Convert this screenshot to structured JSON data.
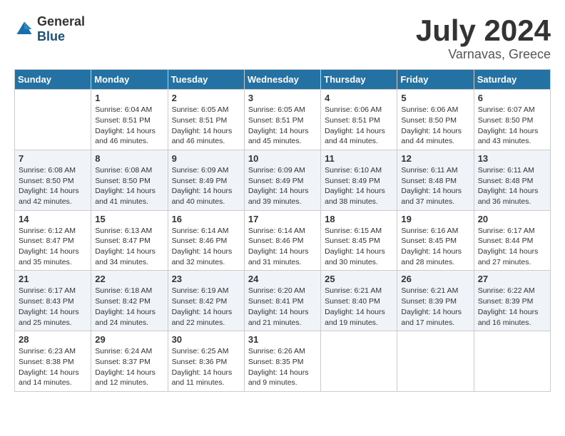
{
  "header": {
    "logo_general": "General",
    "logo_blue": "Blue",
    "month": "July 2024",
    "location": "Varnavas, Greece"
  },
  "weekdays": [
    "Sunday",
    "Monday",
    "Tuesday",
    "Wednesday",
    "Thursday",
    "Friday",
    "Saturday"
  ],
  "weeks": [
    [
      {
        "day": "",
        "info": ""
      },
      {
        "day": "1",
        "info": "Sunrise: 6:04 AM\nSunset: 8:51 PM\nDaylight: 14 hours\nand 46 minutes."
      },
      {
        "day": "2",
        "info": "Sunrise: 6:05 AM\nSunset: 8:51 PM\nDaylight: 14 hours\nand 46 minutes."
      },
      {
        "day": "3",
        "info": "Sunrise: 6:05 AM\nSunset: 8:51 PM\nDaylight: 14 hours\nand 45 minutes."
      },
      {
        "day": "4",
        "info": "Sunrise: 6:06 AM\nSunset: 8:51 PM\nDaylight: 14 hours\nand 44 minutes."
      },
      {
        "day": "5",
        "info": "Sunrise: 6:06 AM\nSunset: 8:50 PM\nDaylight: 14 hours\nand 44 minutes."
      },
      {
        "day": "6",
        "info": "Sunrise: 6:07 AM\nSunset: 8:50 PM\nDaylight: 14 hours\nand 43 minutes."
      }
    ],
    [
      {
        "day": "7",
        "info": "Sunrise: 6:08 AM\nSunset: 8:50 PM\nDaylight: 14 hours\nand 42 minutes."
      },
      {
        "day": "8",
        "info": "Sunrise: 6:08 AM\nSunset: 8:50 PM\nDaylight: 14 hours\nand 41 minutes."
      },
      {
        "day": "9",
        "info": "Sunrise: 6:09 AM\nSunset: 8:49 PM\nDaylight: 14 hours\nand 40 minutes."
      },
      {
        "day": "10",
        "info": "Sunrise: 6:09 AM\nSunset: 8:49 PM\nDaylight: 14 hours\nand 39 minutes."
      },
      {
        "day": "11",
        "info": "Sunrise: 6:10 AM\nSunset: 8:49 PM\nDaylight: 14 hours\nand 38 minutes."
      },
      {
        "day": "12",
        "info": "Sunrise: 6:11 AM\nSunset: 8:48 PM\nDaylight: 14 hours\nand 37 minutes."
      },
      {
        "day": "13",
        "info": "Sunrise: 6:11 AM\nSunset: 8:48 PM\nDaylight: 14 hours\nand 36 minutes."
      }
    ],
    [
      {
        "day": "14",
        "info": "Sunrise: 6:12 AM\nSunset: 8:47 PM\nDaylight: 14 hours\nand 35 minutes."
      },
      {
        "day": "15",
        "info": "Sunrise: 6:13 AM\nSunset: 8:47 PM\nDaylight: 14 hours\nand 34 minutes."
      },
      {
        "day": "16",
        "info": "Sunrise: 6:14 AM\nSunset: 8:46 PM\nDaylight: 14 hours\nand 32 minutes."
      },
      {
        "day": "17",
        "info": "Sunrise: 6:14 AM\nSunset: 8:46 PM\nDaylight: 14 hours\nand 31 minutes."
      },
      {
        "day": "18",
        "info": "Sunrise: 6:15 AM\nSunset: 8:45 PM\nDaylight: 14 hours\nand 30 minutes."
      },
      {
        "day": "19",
        "info": "Sunrise: 6:16 AM\nSunset: 8:45 PM\nDaylight: 14 hours\nand 28 minutes."
      },
      {
        "day": "20",
        "info": "Sunrise: 6:17 AM\nSunset: 8:44 PM\nDaylight: 14 hours\nand 27 minutes."
      }
    ],
    [
      {
        "day": "21",
        "info": "Sunrise: 6:17 AM\nSunset: 8:43 PM\nDaylight: 14 hours\nand 25 minutes."
      },
      {
        "day": "22",
        "info": "Sunrise: 6:18 AM\nSunset: 8:42 PM\nDaylight: 14 hours\nand 24 minutes."
      },
      {
        "day": "23",
        "info": "Sunrise: 6:19 AM\nSunset: 8:42 PM\nDaylight: 14 hours\nand 22 minutes."
      },
      {
        "day": "24",
        "info": "Sunrise: 6:20 AM\nSunset: 8:41 PM\nDaylight: 14 hours\nand 21 minutes."
      },
      {
        "day": "25",
        "info": "Sunrise: 6:21 AM\nSunset: 8:40 PM\nDaylight: 14 hours\nand 19 minutes."
      },
      {
        "day": "26",
        "info": "Sunrise: 6:21 AM\nSunset: 8:39 PM\nDaylight: 14 hours\nand 17 minutes."
      },
      {
        "day": "27",
        "info": "Sunrise: 6:22 AM\nSunset: 8:39 PM\nDaylight: 14 hours\nand 16 minutes."
      }
    ],
    [
      {
        "day": "28",
        "info": "Sunrise: 6:23 AM\nSunset: 8:38 PM\nDaylight: 14 hours\nand 14 minutes."
      },
      {
        "day": "29",
        "info": "Sunrise: 6:24 AM\nSunset: 8:37 PM\nDaylight: 14 hours\nand 12 minutes."
      },
      {
        "day": "30",
        "info": "Sunrise: 6:25 AM\nSunset: 8:36 PM\nDaylight: 14 hours\nand 11 minutes."
      },
      {
        "day": "31",
        "info": "Sunrise: 6:26 AM\nSunset: 8:35 PM\nDaylight: 14 hours\nand 9 minutes."
      },
      {
        "day": "",
        "info": ""
      },
      {
        "day": "",
        "info": ""
      },
      {
        "day": "",
        "info": ""
      }
    ]
  ]
}
